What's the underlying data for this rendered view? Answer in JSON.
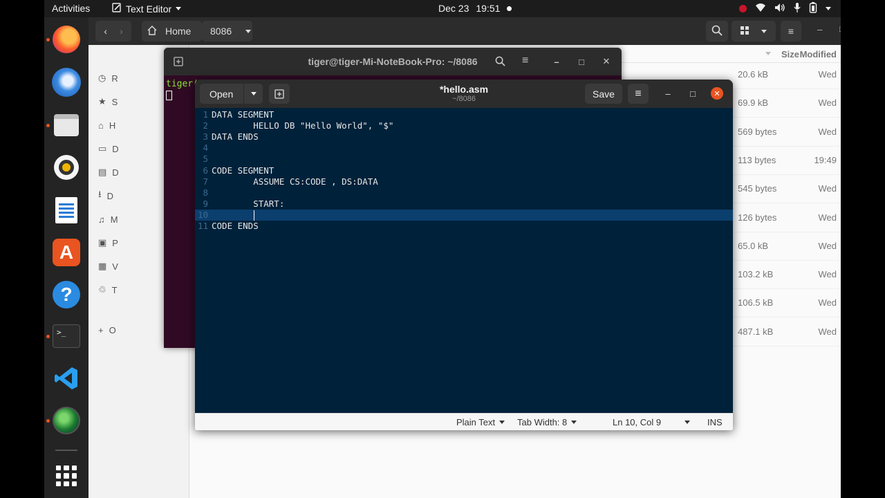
{
  "topbar": {
    "activities": "Activities",
    "app_name": "Text Editor",
    "date": "Dec 23",
    "time": "19:51"
  },
  "dock": {
    "apps": [
      {
        "name": "firefox-icon",
        "running": true
      },
      {
        "name": "thunderbird-icon",
        "running": false
      },
      {
        "name": "files-icon",
        "running": true
      },
      {
        "name": "rhythmbox-icon",
        "running": false
      },
      {
        "name": "libreoffice-writer-icon",
        "running": false
      },
      {
        "name": "software-store-icon",
        "running": false
      },
      {
        "name": "help-icon",
        "running": false
      },
      {
        "name": "terminal-icon",
        "running": true
      },
      {
        "name": "vscode-icon",
        "running": false
      },
      {
        "name": "globe-app-icon",
        "running": true
      }
    ],
    "terminal_glyph": ">_"
  },
  "file_manager": {
    "path": [
      "Home",
      "8086"
    ],
    "columns": {
      "size": "Size",
      "modified": "Modified"
    },
    "sidebar_letters": [
      "R",
      "S",
      "H",
      "D",
      "D",
      "D",
      "M",
      "P",
      "V",
      "T",
      "O"
    ],
    "rows": [
      {
        "size": "20.6 kB",
        "modified": "Wed"
      },
      {
        "size": "69.9 kB",
        "modified": "Wed"
      },
      {
        "size": "569 bytes",
        "modified": "Wed"
      },
      {
        "size": "113 bytes",
        "modified": "19:49"
      },
      {
        "size": "545 bytes",
        "modified": "Wed"
      },
      {
        "size": "126 bytes",
        "modified": "Wed"
      },
      {
        "size": "65.0 kB",
        "modified": "Wed"
      },
      {
        "size": "103.2 kB",
        "modified": "Wed"
      },
      {
        "size": "106.5 kB",
        "modified": "Wed"
      },
      {
        "size": "487.1 kB",
        "modified": "Wed"
      }
    ]
  },
  "terminal": {
    "title": "tiger@tiger-Mi-NoteBook-Pro: ~/8086",
    "prompt_fragment": "tiger("
  },
  "editor": {
    "open_label": "Open",
    "save_label": "Save",
    "filename": "*hello.asm",
    "path": "~/8086",
    "lines": [
      {
        "n": "1",
        "text": "DATA SEGMENT"
      },
      {
        "n": "2",
        "text": "        HELLO DB \"Hello World\", \"$\""
      },
      {
        "n": "3",
        "text": "DATA ENDS"
      },
      {
        "n": "4",
        "text": ""
      },
      {
        "n": "5",
        "text": ""
      },
      {
        "n": "6",
        "text": "CODE SEGMENT"
      },
      {
        "n": "7",
        "text": "        ASSUME CS:CODE , DS:DATA"
      },
      {
        "n": "8",
        "text": ""
      },
      {
        "n": "9",
        "text": "        START:"
      },
      {
        "n": "10",
        "text": "        "
      },
      {
        "n": "11",
        "text": "CODE ENDS"
      }
    ],
    "current_line": 10,
    "status": {
      "language": "Plain Text",
      "tab_width": "Tab Width: 8",
      "position": "Ln 10, Col 9",
      "mode": "INS"
    },
    "colors": {
      "background": "#00213a",
      "current_line": "#0b3f6e",
      "close_button": "#e95420"
    }
  }
}
